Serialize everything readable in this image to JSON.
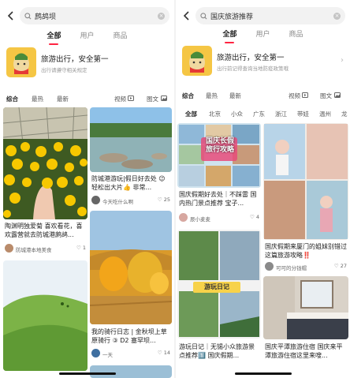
{
  "left": {
    "search_query": "鹧鸪坝",
    "tabs": [
      "全部",
      "用户",
      "商品"
    ],
    "tip_title": "旅游出行，安全第一",
    "tip_sub": "出行请遵守相关规定",
    "filters": [
      "综合",
      "最热",
      "最新",
      "视频",
      "图文"
    ],
    "cards": [
      {
        "caption": "陶渊明独爱菊 喜欢看花，喜欢露营就去防城港鹧鸪...",
        "author": "防城港本地美食",
        "likes": "1"
      },
      {
        "caption": "防城港游玩|假日好去处 😉轻松出大片👍 非常...",
        "author": "今天吃什么啊",
        "likes": "25"
      },
      {
        "caption": "我的骑行日志 | 金秋坝上草原骑行 ③ D2 塞罕坝...",
        "author": "一天",
        "likes": "14"
      },
      {
        "caption": "",
        "author": "",
        "likes": ""
      }
    ]
  },
  "right": {
    "search_query": "国庆旅游推荐",
    "tabs": [
      "全部",
      "用户",
      "商品"
    ],
    "tip_title": "旅游出行，安全第一",
    "tip_sub": "出行前记得查询当地防疫政策哦",
    "filters": [
      "综合",
      "最热",
      "最新",
      "视频",
      "图文"
    ],
    "chips": [
      "全部",
      "北京",
      "小众",
      "广东",
      "浙江",
      "带娃",
      "温州",
      "龙"
    ],
    "cards": [
      {
        "caption": "国庆假期好去处｜不踩雷 国内热门景点推荐 宝子...",
        "author": "辰小麦麦",
        "likes": "4",
        "overlay": "国庆长假 旅行攻略"
      },
      {
        "caption": "国庆假期来厦门的姐妹别错过这篇旅游攻略‼️",
        "author": "可可的分钱帽",
        "likes": "27",
        "overlay": ""
      },
      {
        "caption": "游玩日记｜无锡小众旅游景点推荐1️⃣ 国庆假期...",
        "author": "",
        "likes": "",
        "overlay": "游玩日记"
      },
      {
        "caption": "国庆平潭旅游住宿 国庆来平潭旅游住宿这里来嗖...",
        "author": "",
        "likes": "",
        "overlay": ""
      }
    ]
  },
  "colors": {
    "accent": "#ff2442",
    "tip_bg": "#f5c644"
  }
}
